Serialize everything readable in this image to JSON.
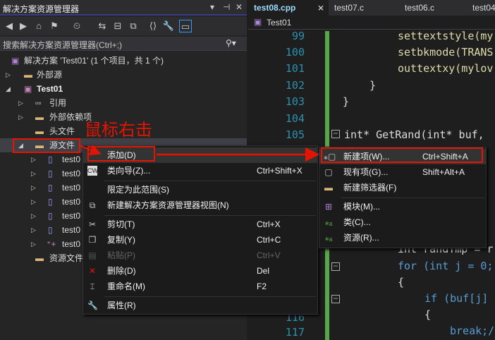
{
  "solution_panel": {
    "title": "解决方案资源管理器",
    "search_placeholder": "搜索解决方案资源管理器(Ctrl+;)",
    "tree": [
      {
        "label": "解决方案 'Test01' (1 个项目，共 1 个)"
      },
      {
        "label": "外部源"
      },
      {
        "label": "Test01"
      },
      {
        "label": "引用"
      },
      {
        "label": "外部依赖项"
      },
      {
        "label": "头文件"
      },
      {
        "label": "源文件"
      },
      {
        "label": "test0"
      },
      {
        "label": "test0"
      },
      {
        "label": "test0"
      },
      {
        "label": "test0"
      },
      {
        "label": "test0"
      },
      {
        "label": "test0"
      },
      {
        "label": "test0"
      },
      {
        "label": "资源文件"
      }
    ]
  },
  "annotation": {
    "text": "鼠标右击",
    "color": "#e51400"
  },
  "editor": {
    "tabs": [
      {
        "label": "test08.cpp"
      },
      {
        "label": "test07.c"
      },
      {
        "label": "test06.c"
      },
      {
        "label": "test04"
      }
    ],
    "project_dropdown": "Test01",
    "lines": [
      {
        "num": "99",
        "code": "settextstyle(my"
      },
      {
        "num": "100",
        "code": "setbkmode(TRANS"
      },
      {
        "num": "101",
        "code": "outtextxy(mylov"
      },
      {
        "num": "102",
        "code": "}"
      },
      {
        "num": "103",
        "code": "}"
      },
      {
        "num": "104",
        "code": ""
      },
      {
        "num": "105",
        "code": "int* GetRand(int* buf,"
      },
      {
        "num": "",
        "code": "int randTmp = r"
      },
      {
        "num": "",
        "code": "for (int j = 0;"
      },
      {
        "num": "",
        "code": "{"
      },
      {
        "num": "",
        "code": "if (buf[j]"
      },
      {
        "num": "116",
        "code": "{"
      },
      {
        "num": "117",
        "code": "break;/"
      }
    ]
  },
  "context_menu": {
    "items": [
      {
        "label": "添加(D)",
        "shortcut": ""
      },
      {
        "label": "类向导(Z)...",
        "shortcut": "Ctrl+Shift+X"
      },
      {
        "label": "限定为此范围(S)",
        "shortcut": ""
      },
      {
        "label": "新建解决方案资源管理器视图(N)",
        "shortcut": ""
      },
      {
        "label": "剪切(T)",
        "shortcut": "Ctrl+X"
      },
      {
        "label": "复制(Y)",
        "shortcut": "Ctrl+C"
      },
      {
        "label": "粘贴(P)",
        "shortcut": "Ctrl+V"
      },
      {
        "label": "删除(D)",
        "shortcut": "Del"
      },
      {
        "label": "重命名(M)",
        "shortcut": "F2"
      },
      {
        "label": "属性(R)",
        "shortcut": ""
      }
    ]
  },
  "submenu": {
    "items": [
      {
        "label": "新建项(W)...",
        "shortcut": "Ctrl+Shift+A"
      },
      {
        "label": "现有项(G)...",
        "shortcut": "Shift+Alt+A"
      },
      {
        "label": "新建筛选器(F)",
        "shortcut": ""
      },
      {
        "label": "模块(M)...",
        "shortcut": ""
      },
      {
        "label": "类(C)...",
        "shortcut": ""
      },
      {
        "label": "资源(R)...",
        "shortcut": ""
      }
    ]
  }
}
